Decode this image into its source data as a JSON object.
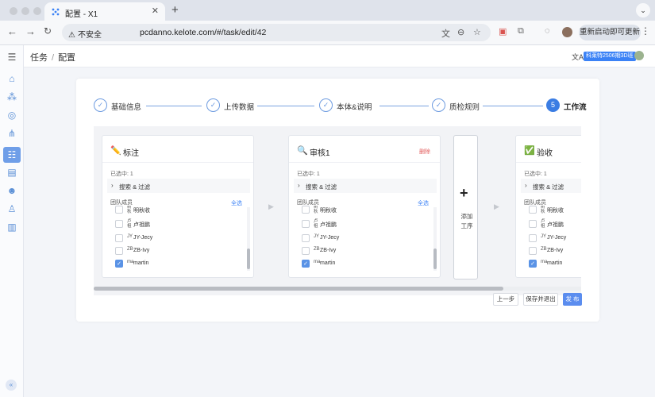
{
  "browser": {
    "tab_title": "配置 - X1",
    "insecure_label": "不安全",
    "url": "pcdanno.kelote.com/#/task/edit/42",
    "relaunch_label": "重新启动即可更新"
  },
  "header": {
    "breadcrumb": [
      "任务",
      "配置"
    ],
    "badge": "科莱特2506期3D班"
  },
  "steps": [
    {
      "index": "✓",
      "label": "基础信息",
      "state": "done"
    },
    {
      "index": "✓",
      "label": "上传数据",
      "state": "done"
    },
    {
      "index": "✓",
      "label": "本体&说明",
      "state": "done"
    },
    {
      "index": "✓",
      "label": "质检规则",
      "state": "done"
    },
    {
      "index": "5",
      "label": "工作流",
      "state": "current"
    }
  ],
  "workflow": {
    "selected_label": "已选中: 1",
    "filter_label": "搜索 & 过滤",
    "member_header": "团队成员",
    "select_all": "全选",
    "delete_label": "删除",
    "add_stage_label": "添加工序",
    "stages": [
      {
        "icon": "pencil",
        "title": "标注",
        "members": [
          {
            "abbr": "树秋",
            "name": "明秋收",
            "checked": false
          },
          {
            "abbr": "卢祖",
            "name": "卢祖鹏",
            "checked": false
          },
          {
            "abbr": "JY",
            "name": "JY-Jecy",
            "checked": false
          },
          {
            "abbr": "ZB",
            "name": "ZB-Ivy",
            "checked": false
          },
          {
            "abbr": "ma",
            "name": "martin",
            "checked": true
          }
        ]
      },
      {
        "icon": "magnifier",
        "title": "审核1",
        "members": [
          {
            "abbr": "树秋",
            "name": "明秋收",
            "checked": false
          },
          {
            "abbr": "卢祖",
            "name": "卢祖鹏",
            "checked": false
          },
          {
            "abbr": "JY",
            "name": "JY-Jecy",
            "checked": false
          },
          {
            "abbr": "ZB",
            "name": "ZB-Ivy",
            "checked": false
          },
          {
            "abbr": "ma",
            "name": "martin",
            "checked": true
          }
        ]
      },
      {
        "icon": "checkmark",
        "title": "验收",
        "members": [
          {
            "abbr": "树秋",
            "name": "明秋收",
            "checked": false
          },
          {
            "abbr": "卢祖",
            "name": "卢祖鹏",
            "checked": false
          },
          {
            "abbr": "JY",
            "name": "JY-Jecy",
            "checked": false
          },
          {
            "abbr": "ZB",
            "name": "ZB-Ivy",
            "checked": false
          },
          {
            "abbr": "ma",
            "name": "martin",
            "checked": true
          }
        ]
      }
    ]
  },
  "actions": {
    "prev": "上一步",
    "save_exit": "保存并退出",
    "publish": "发 布"
  }
}
